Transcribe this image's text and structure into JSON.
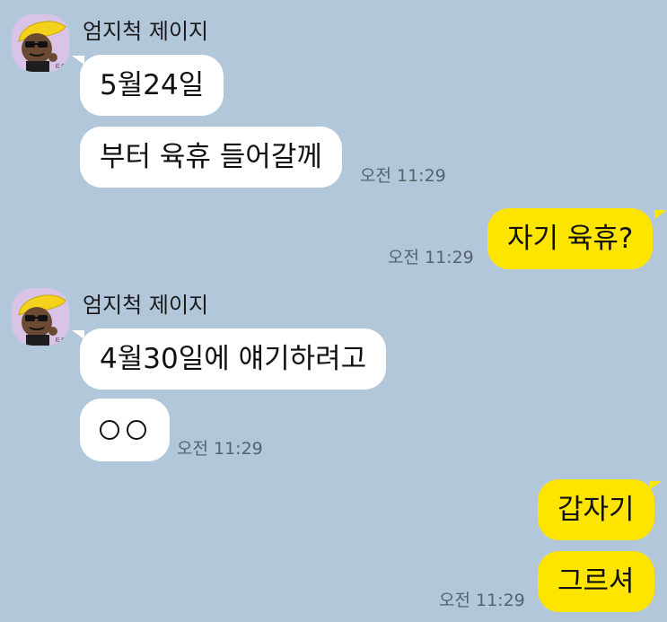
{
  "chat": {
    "messages": [
      {
        "sender": "엄지척 제이지",
        "text": "5월24일"
      },
      {
        "sender": "엄지척 제이지",
        "text": "부터 육휴 들어갈께",
        "time": "오전 11:29"
      },
      {
        "sender": "me",
        "text": "자기 육휴?",
        "time": "오전 11:29"
      },
      {
        "sender": "엄지척 제이지",
        "text": "4월30일에 얘기하려고"
      },
      {
        "sender": "엄지척 제이지",
        "text": "ㅇㅇ",
        "time": "오전 11:29"
      },
      {
        "sender": "me",
        "text": "갑자기"
      },
      {
        "sender": "me",
        "text": "그르셔",
        "time": "오전 11:29"
      }
    ]
  },
  "theme": {
    "background": "#b2c7da",
    "incoming_bubble": "#ffffff",
    "outgoing_bubble": "#fee500",
    "avatar_bg": "#d9c3e6"
  },
  "icons": {
    "avatar": "sunglasses-character-avatar-icon"
  }
}
